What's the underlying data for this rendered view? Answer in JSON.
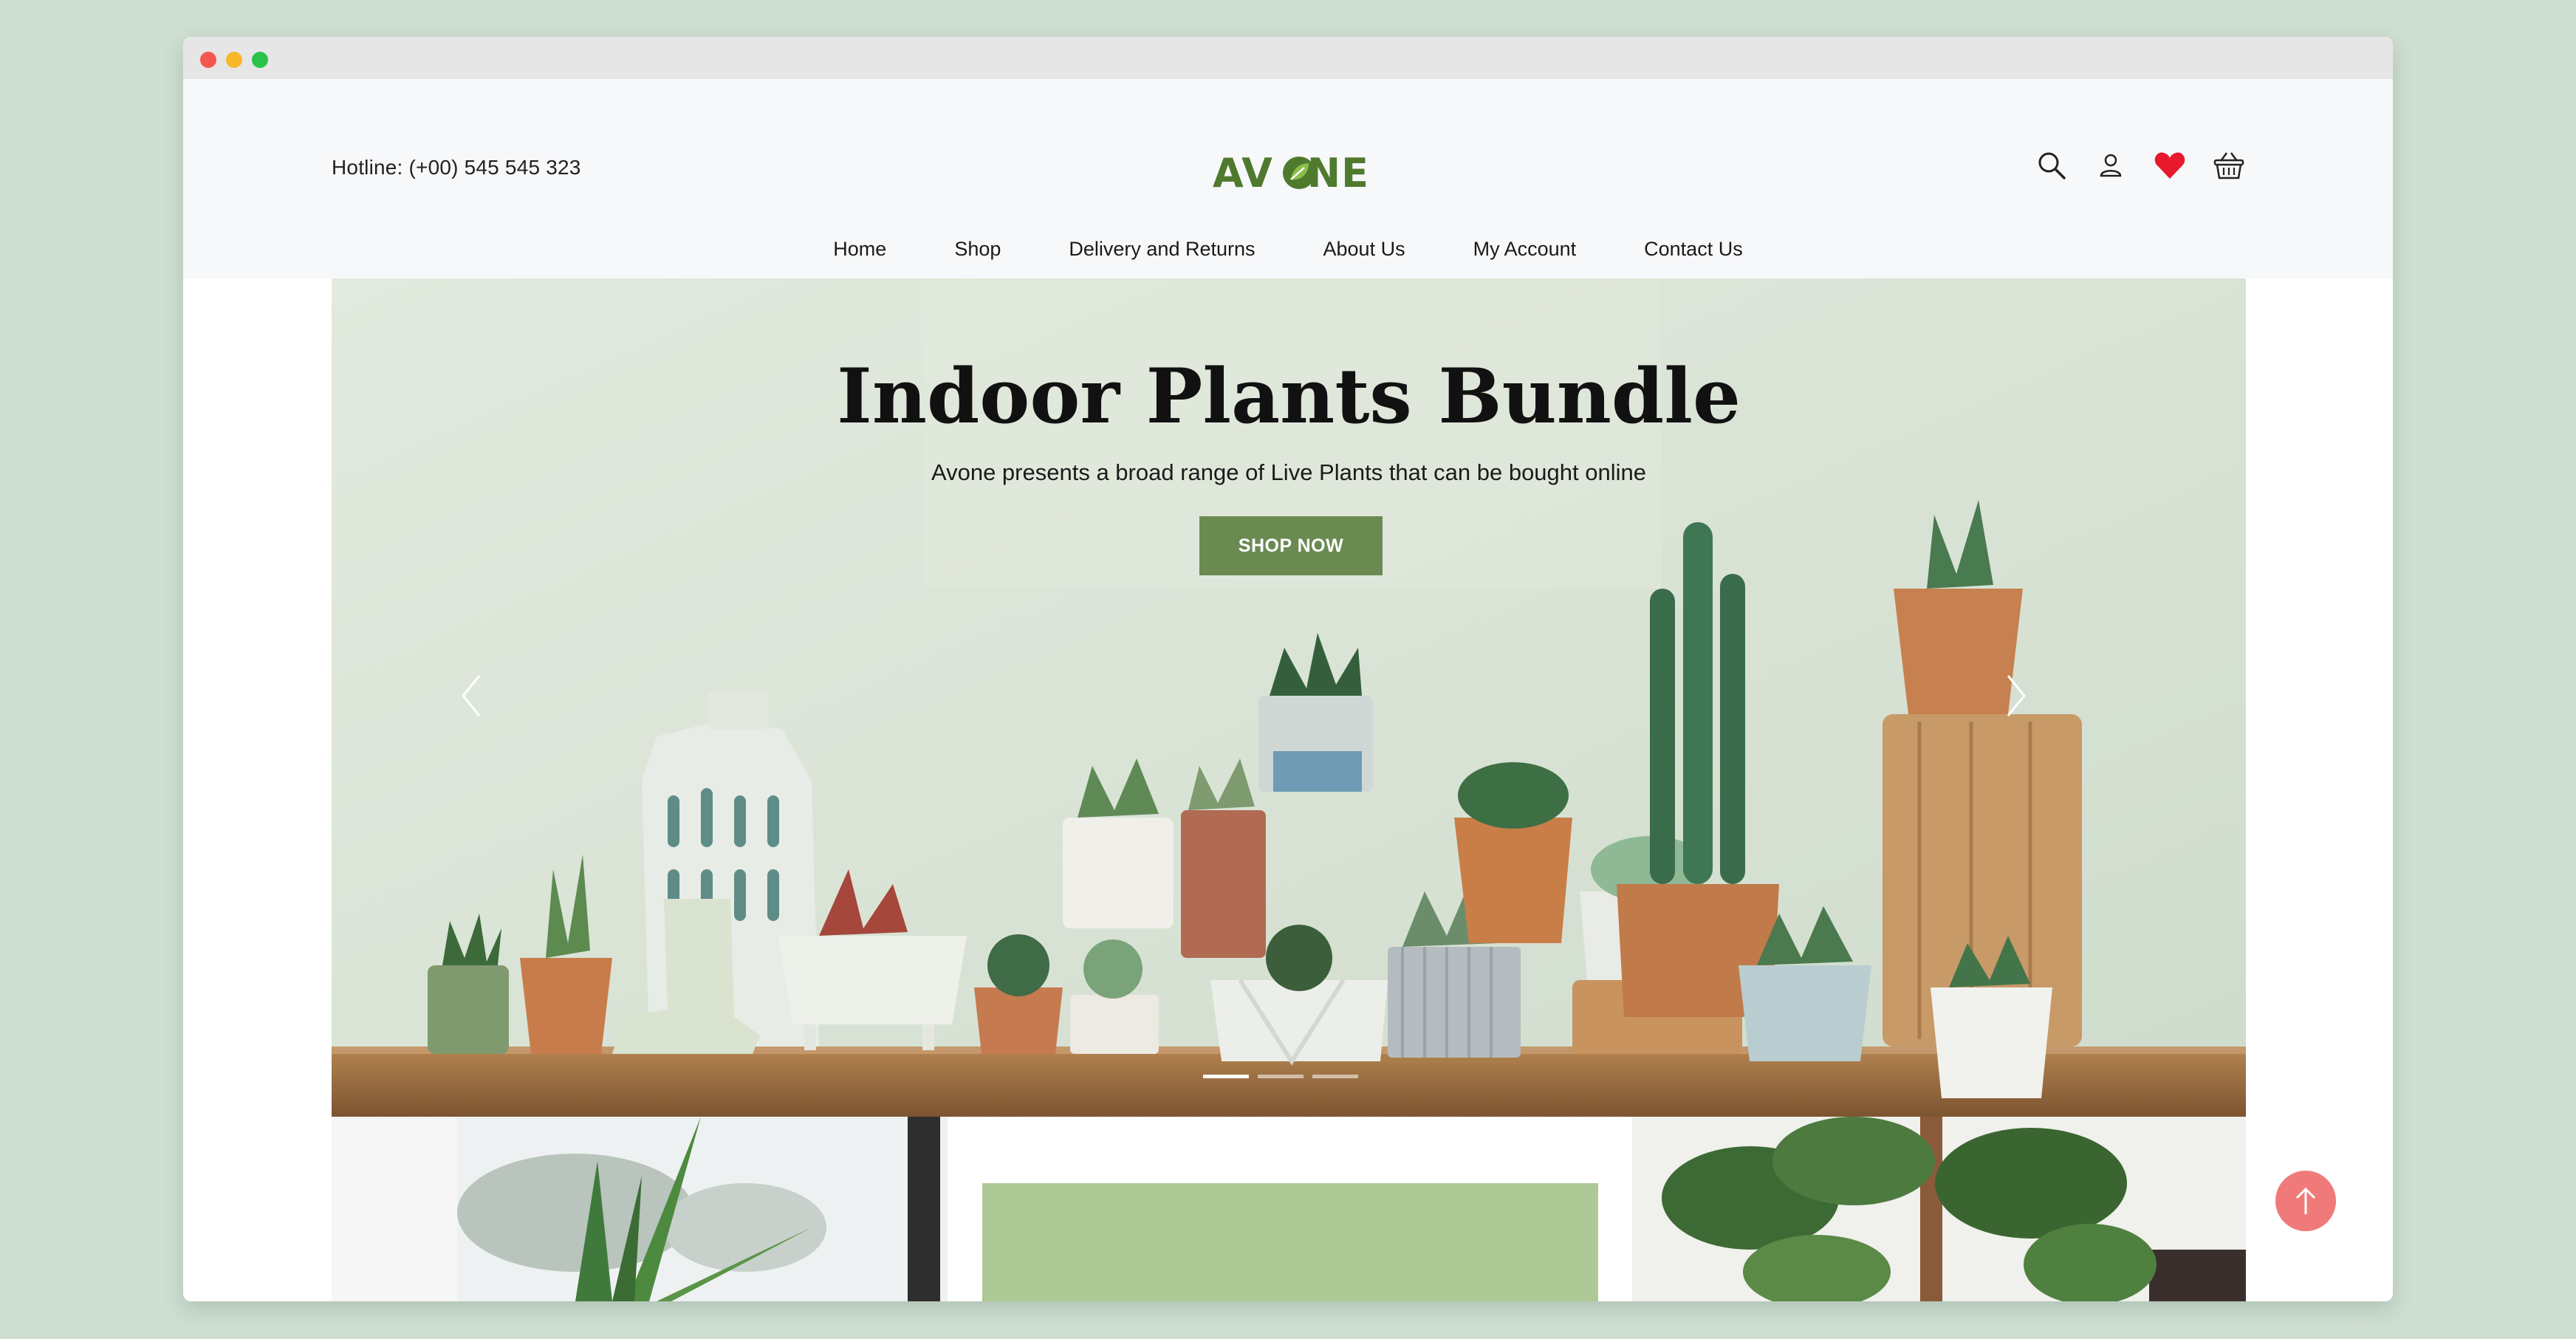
{
  "header": {
    "hotline": "Hotline: (+00) 545 545 323",
    "logo_text": "AVONE"
  },
  "nav": {
    "items": [
      "Home",
      "Shop",
      "Delivery and Returns",
      "About Us",
      "My Account",
      "Contact Us"
    ]
  },
  "icons": [
    "search-icon",
    "user-icon",
    "heart-icon",
    "basket-icon"
  ],
  "hero": {
    "title": "Indoor Plants Bundle",
    "subtitle": "Avone presents a broad range of Live Plants that can be bought online",
    "button_label": "SHOP NOW",
    "slides": 3,
    "active_slide": 1
  },
  "colors": {
    "page_bg": "#cfdfd2",
    "brand_green": "#4f7a2e",
    "button_green": "#6a8a52",
    "wishlist_red": "#e8192c",
    "to_top": "#f07a7a"
  }
}
